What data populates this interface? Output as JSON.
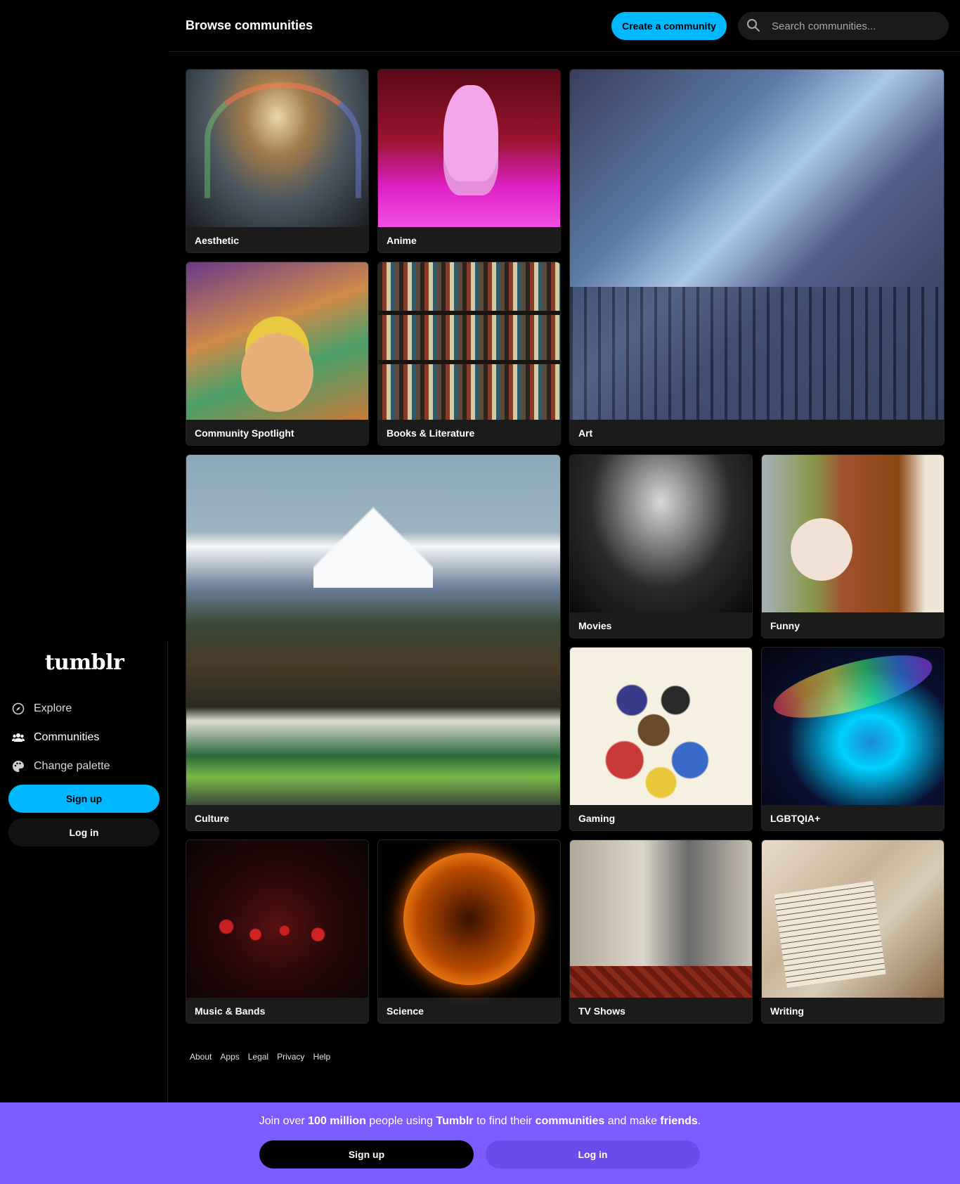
{
  "header": {
    "title": "Browse communities",
    "create_label": "Create a community",
    "search_placeholder": "Search communities..."
  },
  "sidebar": {
    "logo": "tumblr",
    "items": [
      {
        "label": "Explore",
        "icon": "compass-icon"
      },
      {
        "label": "Communities",
        "icon": "people-icon"
      },
      {
        "label": "Change palette",
        "icon": "palette-icon"
      }
    ],
    "signup_label": "Sign up",
    "login_label": "Log in"
  },
  "communities": [
    {
      "label": "Aesthetic"
    },
    {
      "label": "Anime"
    },
    {
      "label": "Art"
    },
    {
      "label": "Community Spotlight"
    },
    {
      "label": "Books & Literature"
    },
    {
      "label": "Culture"
    },
    {
      "label": "Movies"
    },
    {
      "label": "Funny"
    },
    {
      "label": "Gaming"
    },
    {
      "label": "LGBTQIA+"
    },
    {
      "label": "Music & Bands"
    },
    {
      "label": "Science"
    },
    {
      "label": "TV Shows"
    },
    {
      "label": "Writing"
    }
  ],
  "footer": {
    "links": [
      "About",
      "Apps",
      "Legal",
      "Privacy",
      "Help"
    ]
  },
  "banner": {
    "text_1": "Join over ",
    "text_2": "100 million",
    "text_3": " people using ",
    "text_4": "Tumblr",
    "text_5": " to find their ",
    "text_6": "communities",
    "text_7": " and make ",
    "text_8": "friends",
    "text_9": ".",
    "signup_label": "Sign up",
    "login_label": "Log in"
  },
  "colors": {
    "accent": "#00b8ff",
    "banner": "#7c5cff",
    "background": "#000000"
  }
}
